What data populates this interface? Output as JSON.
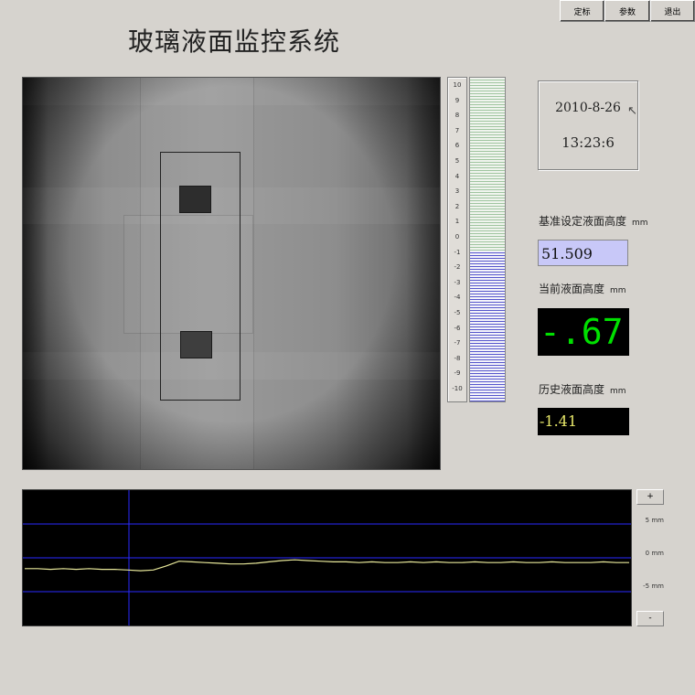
{
  "header": {
    "title": "玻璃液面监控系统",
    "buttons": [
      {
        "label": "定标"
      },
      {
        "label": "参数"
      },
      {
        "label": "退出"
      }
    ]
  },
  "camera_view": {
    "icon": "camera-feed"
  },
  "level_gauge": {
    "scale_labels": [
      "10",
      "9",
      "8",
      "7",
      "6",
      "5",
      "4",
      "3",
      "2",
      "1",
      "0",
      "-1",
      "-2",
      "-3",
      "-4",
      "-5",
      "-6",
      "-7",
      "-8",
      "-9",
      "-10"
    ],
    "current_level": -0.67,
    "range": [
      -10,
      10
    ],
    "colors": {
      "upper": "#9fc59f",
      "lower": "#5555cc"
    }
  },
  "datetime": {
    "date": "2010-8-26",
    "time": "13:23:6"
  },
  "baseline": {
    "label": "基准设定液面高度",
    "unit": "mm",
    "value": "51.509"
  },
  "current": {
    "label": "当前液面高度",
    "unit": "mm",
    "value": "-.67",
    "color": "#00e000"
  },
  "history": {
    "label": "历史液面高度",
    "unit": "mm",
    "value": "-1.41",
    "color": "#e8e86a"
  },
  "trend_chart": {
    "plus_label": "+",
    "minus_label": "-",
    "axis_labels": [
      "5 mm",
      "0 mm",
      "-5 mm"
    ],
    "line_color": "#e8e89a",
    "grid_color": "#2a2aff"
  },
  "chart_data": {
    "type": "line",
    "title": "",
    "xlabel": "",
    "ylabel": "",
    "ylim": [
      -10,
      10
    ],
    "y_ticks": [
      "5 mm",
      "0 mm",
      "-5 mm"
    ],
    "series": [
      {
        "values": [
          -1.6,
          -1.6,
          -1.7,
          -1.6,
          -1.7,
          -1.6,
          -1.7,
          -1.7,
          -1.8,
          -1.9,
          -1.8,
          -1.2,
          -0.5,
          -0.6,
          -0.7,
          -0.8,
          -0.9,
          -0.9,
          -0.8,
          -0.6,
          -0.4,
          -0.3,
          -0.4,
          -0.5,
          -0.6,
          -0.6,
          -0.7,
          -0.6,
          -0.7,
          -0.7,
          -0.6,
          -0.7,
          -0.6,
          -0.7,
          -0.7,
          -0.6,
          -0.7,
          -0.7,
          -0.6,
          -0.7,
          -0.7,
          -0.6,
          -0.7,
          -0.7,
          -0.7,
          -0.6,
          -0.7,
          -0.7
        ]
      }
    ]
  }
}
